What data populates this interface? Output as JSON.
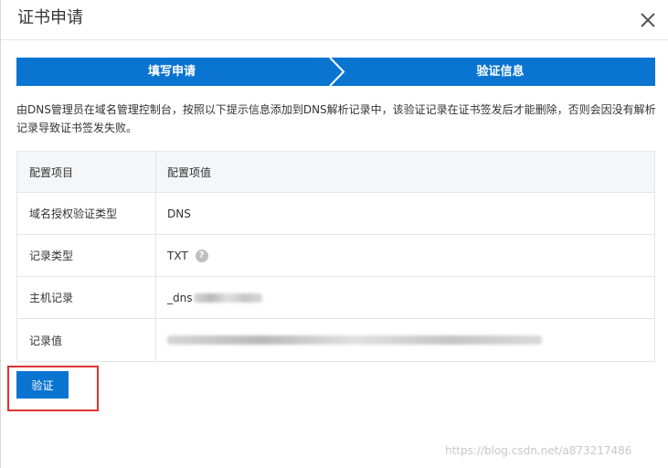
{
  "dialog": {
    "title": "证书申请",
    "close_icon": "close-icon"
  },
  "steps": [
    {
      "label": "填写申请"
    },
    {
      "label": "验证信息"
    }
  ],
  "description": "由DNS管理员在域名管理控制台，按照以下提示信息添加到DNS解析记录中，该验证记录在证书签发后才能删除，否则会因没有解析记录导致证书签发失败。",
  "table": {
    "headers": [
      "配置项目",
      "配置项值"
    ],
    "rows": [
      {
        "key": "域名授权验证类型",
        "value": "DNS"
      },
      {
        "key": "记录类型",
        "value": "TXT",
        "help_icon": "question-circle-icon"
      },
      {
        "key": "主机记录",
        "value": "_dns"
      },
      {
        "key": "记录值",
        "value": ""
      }
    ]
  },
  "actions": {
    "verify_label": "验证"
  },
  "watermark": "https://blog.csdn.net/a873217486",
  "colors": {
    "primary": "#0a74d1",
    "highlight": "#e03232"
  }
}
